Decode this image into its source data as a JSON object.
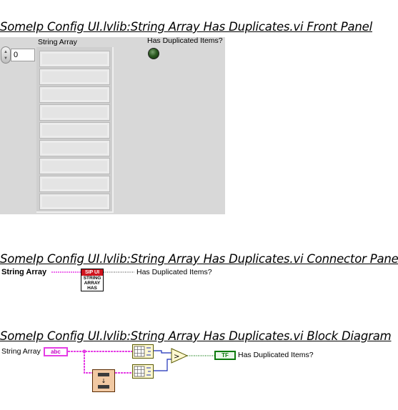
{
  "front_panel": {
    "title": "SomeIp Config UI.lvlib:String Array Has Duplicates.vi Front Panel",
    "array_label": "String Array",
    "array_index": "0",
    "led_label": "Has Duplicated Items?",
    "array_visible_elements": 9
  },
  "connector_pane": {
    "title": "SomeIp Config UI.lvlib:String Array Has Duplicates.vi Connector Pane",
    "input_label": "String Array",
    "output_label": "Has Duplicated Items?",
    "icon_header": "SIP UI",
    "icon_lines": [
      "STRING",
      "ARRAY",
      "HAS"
    ]
  },
  "block_diagram": {
    "title": "SomeIp Config UI.lvlib:String Array Has Duplicates.vi Block Diagram",
    "input_label": "String Array",
    "input_terminal": "abc",
    "output_label": "Has Duplicated Items?",
    "output_terminal": "TF"
  },
  "colors": {
    "panel_bg": "#d8d8d8",
    "string_wire": "#e53ee5",
    "numeric_wire": "#1a2fb8",
    "boolean_wire": "#0c7a0c",
    "led_off": "#2c5a22",
    "icon_header": "#d0141e"
  }
}
